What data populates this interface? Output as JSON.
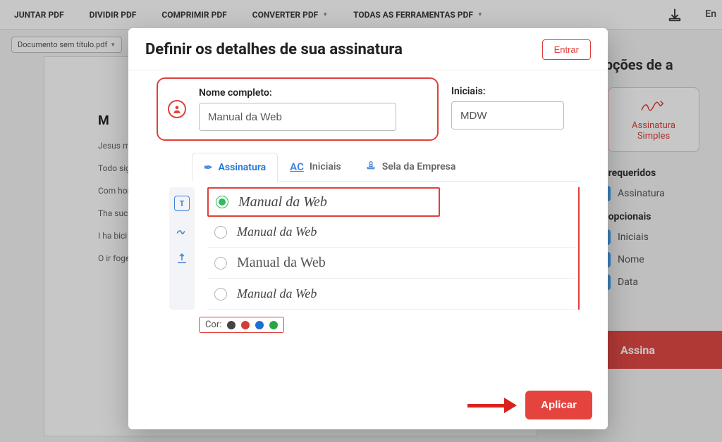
{
  "topnav": {
    "items": [
      "JUNTAR PDF",
      "DIVIDIR PDF",
      "COMPRIMIR PDF",
      "CONVERTER PDF",
      "TODAS AS FERRAMENTAS PDF"
    ],
    "right": "En"
  },
  "docbar": {
    "filename": "Documento sem título.pdf"
  },
  "background_doc": {
    "heading": "M",
    "p1": "Jesus mal alga",
    "p2": "Todo sigr que",
    "p3": "Com hom nac para",
    "p4": "Tha suc bici",
    "p5": "I ha bici mos",
    "p6": "O ir foge cobrador.... Há males que vêm para o pior. O sonho não acabou. E ainda tens pão doce,"
  },
  "rightpanel": {
    "title": "Opções de a",
    "card_line1": "Assinatura",
    "card_line2": "Simples",
    "req_title": "os requeridos",
    "req_item": "Assinatura",
    "opt_title": "os opcionais",
    "opt_items": [
      "Iniciais",
      "Nome",
      "Data"
    ],
    "cta": "Assina"
  },
  "modal": {
    "title": "Definir os detalhes de sua assinatura",
    "login": "Entrar",
    "full_name_label": "Nome completo:",
    "full_name_value": "Manual da Web",
    "initials_label": "Iniciais:",
    "initials_value": "MDW",
    "tabs": {
      "sig": "Assinatura",
      "ini": "Iniciais",
      "stamp": "Sela da Empresa"
    },
    "sigtext": "Manual da Web",
    "cor_label": "Cor:",
    "apply": "Aplicar"
  }
}
